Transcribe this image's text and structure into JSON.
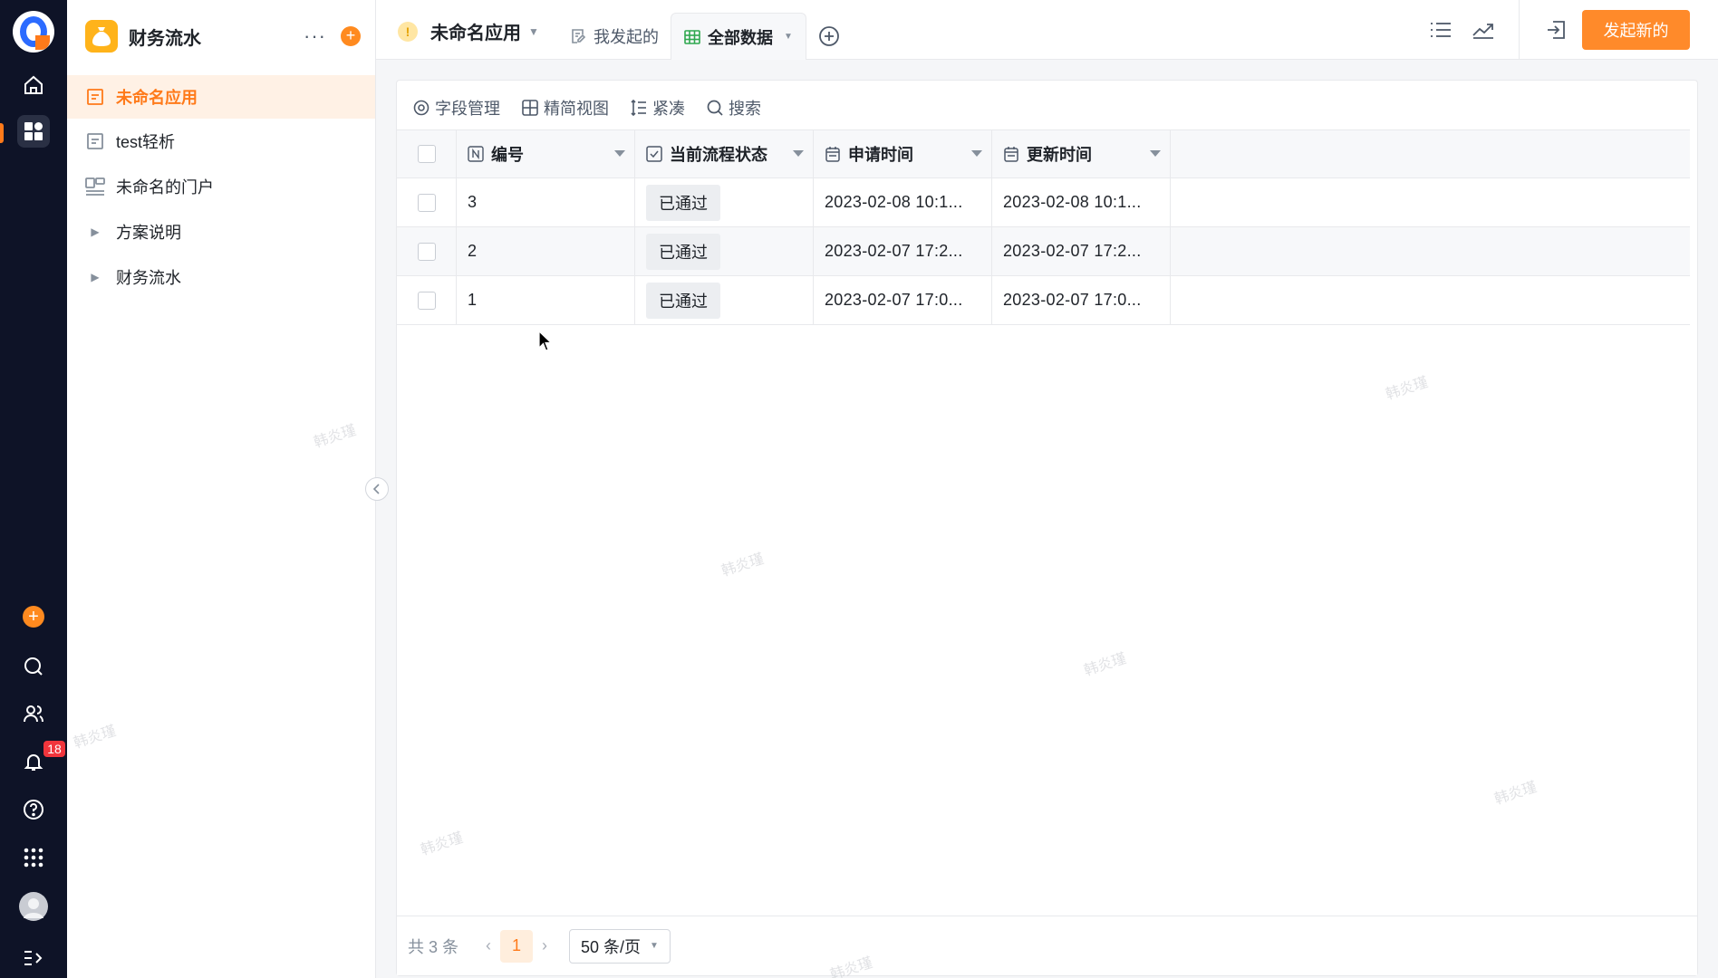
{
  "sidebar": {
    "title": "财务流水",
    "items": [
      {
        "label": "未命名应用",
        "icon": "form-icon",
        "active": true
      },
      {
        "label": "test轻析",
        "icon": "form-icon"
      },
      {
        "label": "未命名的门户",
        "icon": "portal-icon"
      },
      {
        "label": "方案说明",
        "icon": "caret-right-icon"
      },
      {
        "label": "财务流水",
        "icon": "caret-right-icon"
      }
    ]
  },
  "rail": {
    "notification_count": "18"
  },
  "topbar": {
    "app_name": "未命名应用",
    "warn_glyph": "!",
    "tabs": [
      {
        "label": "我发起的"
      },
      {
        "label": "全部数据"
      }
    ],
    "new_button": "发起新的"
  },
  "toolbar": {
    "field_manage": "字段管理",
    "simple_view": "精简视图",
    "compact": "紧凑",
    "search": "搜索"
  },
  "table": {
    "columns": [
      "编号",
      "当前流程状态",
      "申请时间",
      "更新时间"
    ],
    "rows": [
      {
        "id": "3",
        "status": "已通过",
        "apply_time": "2023-02-08 10:1...",
        "update_time": "2023-02-08 10:1..."
      },
      {
        "id": "2",
        "status": "已通过",
        "apply_time": "2023-02-07 17:2...",
        "update_time": "2023-02-07 17:2..."
      },
      {
        "id": "1",
        "status": "已通过",
        "apply_time": "2023-02-07 17:0...",
        "update_time": "2023-02-07 17:0..."
      }
    ]
  },
  "pagination": {
    "total": "共 3 条",
    "current_page": "1",
    "page_size": "50 条/页"
  },
  "watermark_text": "韩炎瑾",
  "colors": {
    "accent": "#ff8a2a",
    "rail_bg": "#0e1327",
    "active_item_bg": "#fff1e5"
  }
}
